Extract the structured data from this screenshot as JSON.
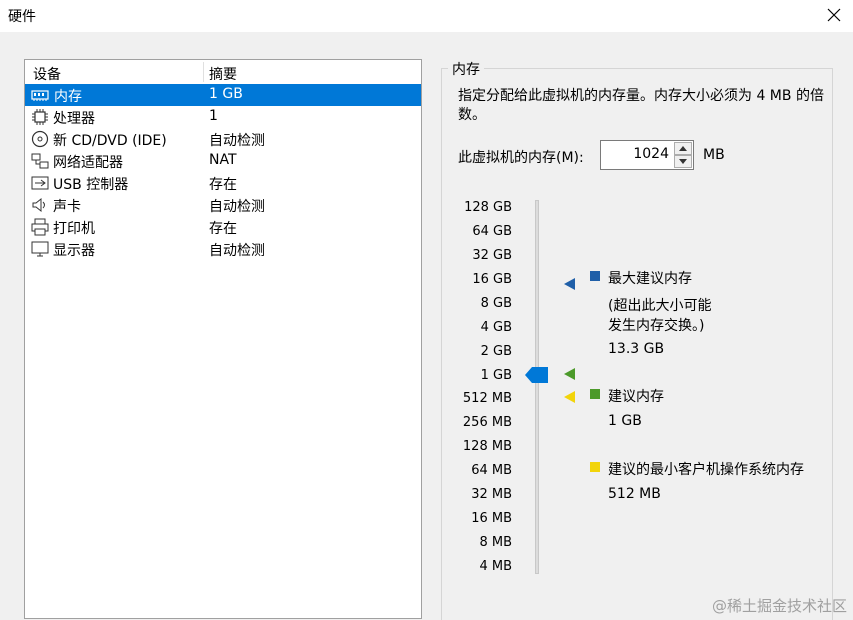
{
  "window": {
    "title": "硬件"
  },
  "device_list": {
    "columns": [
      "设备",
      "摘要"
    ],
    "items": [
      {
        "name": "内存",
        "summary": "1 GB",
        "icon": "memory-icon",
        "selected": true
      },
      {
        "name": "处理器",
        "summary": "1",
        "icon": "cpu-icon"
      },
      {
        "name": "新 CD/DVD (IDE)",
        "summary": "自动检测",
        "icon": "cd-icon"
      },
      {
        "name": "网络适配器",
        "summary": "NAT",
        "icon": "network-icon"
      },
      {
        "name": "USB 控制器",
        "summary": "存在",
        "icon": "usb-icon"
      },
      {
        "name": "声卡",
        "summary": "自动检测",
        "icon": "speaker-icon"
      },
      {
        "name": "打印机",
        "summary": "存在",
        "icon": "printer-icon"
      },
      {
        "name": "显示器",
        "summary": "自动检测",
        "icon": "monitor-icon"
      }
    ]
  },
  "memory_panel": {
    "group_title": "内存",
    "description": "指定分配给此虚拟机的内存量。内存大小必须为 4 MB 的倍数。",
    "memory_label": "此虚拟机的内存(M):",
    "memory_value": "1024",
    "unit": "MB",
    "scale_labels": [
      "128 GB",
      "64 GB",
      "32 GB",
      "16 GB",
      "8 GB",
      "4 GB",
      "2 GB",
      "1 GB",
      "512 MB",
      "256 MB",
      "128 MB",
      "64 MB",
      "32 MB",
      "16 MB",
      "8 MB",
      "4 MB"
    ],
    "legend": {
      "max": {
        "label": "最大建议内存",
        "note_line1": "(超出此大小可能",
        "note_line2": "发生内存交换。)",
        "value": "13.3 GB",
        "color": "#1f5fa8"
      },
      "recommended": {
        "label": "建议内存",
        "value": "1 GB",
        "color": "#4c9a2a"
      },
      "min_guest": {
        "label": "建议的最小客户机操作系统内存",
        "value": "512 MB",
        "color": "#f2d40a"
      }
    },
    "slider_color": "#0078d7"
  },
  "watermark": "@稀土掘金技术社区"
}
